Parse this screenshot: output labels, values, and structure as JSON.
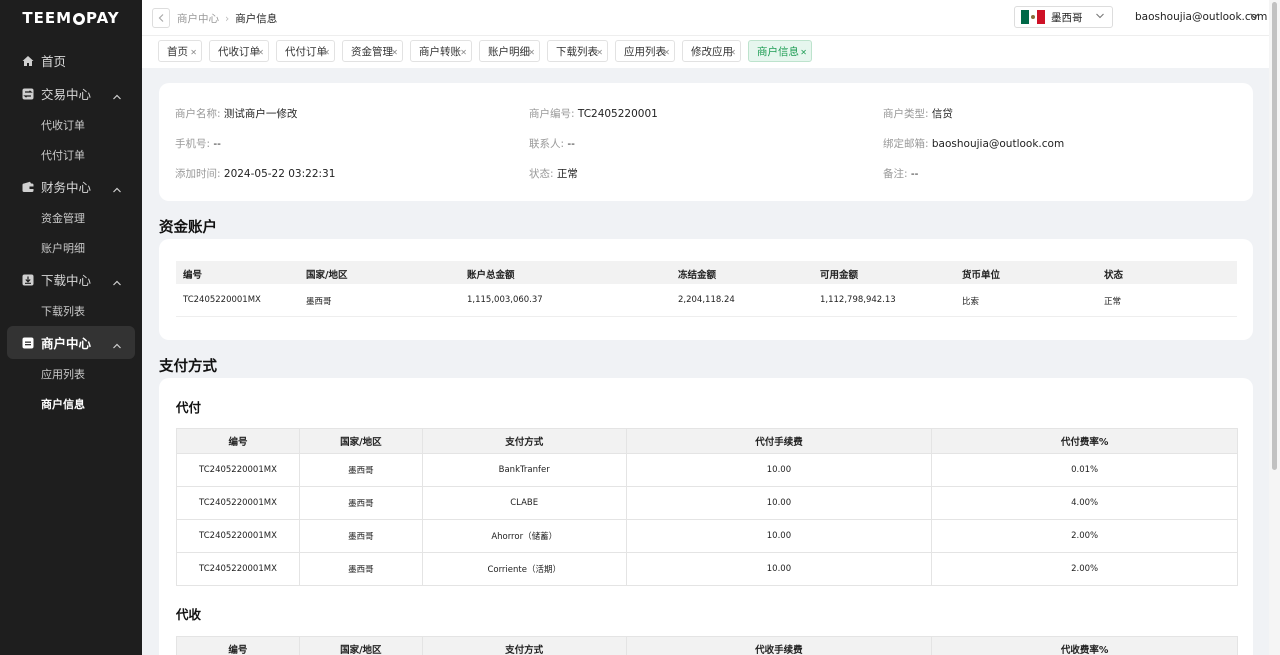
{
  "app": {
    "logo_left": "TEEM",
    "logo_right": "PAY"
  },
  "sidebar": {
    "items": [
      {
        "type": "top",
        "label": "首页",
        "icon": "home-icon",
        "name": "home"
      },
      {
        "type": "top",
        "label": "交易中心",
        "icon": "exchange-icon",
        "name": "trade-center",
        "expanded": true
      },
      {
        "type": "sub",
        "label": "代收订单",
        "name": "collection-orders"
      },
      {
        "type": "sub",
        "label": "代付订单",
        "name": "payout-orders"
      },
      {
        "type": "top",
        "label": "财务中心",
        "icon": "wallet-icon",
        "name": "finance-center",
        "expanded": true
      },
      {
        "type": "sub",
        "label": "资金管理",
        "name": "fund-management"
      },
      {
        "type": "sub",
        "label": "账户明细",
        "name": "account-details"
      },
      {
        "type": "top",
        "label": "下载中心",
        "icon": "download-icon",
        "name": "download-center",
        "expanded": true
      },
      {
        "type": "sub",
        "label": "下载列表",
        "name": "download-list"
      },
      {
        "type": "top",
        "label": "商户中心",
        "icon": "merchant-icon",
        "name": "merchant-center",
        "expanded": true,
        "active": true
      },
      {
        "type": "sub",
        "label": "应用列表",
        "name": "app-list"
      },
      {
        "type": "sub",
        "label": "商户信息",
        "name": "merchant-info",
        "active": true
      }
    ]
  },
  "header": {
    "breadcrumb": [
      "商户中心",
      "商户信息"
    ],
    "country": "墨西哥",
    "user_email": "baoshoujia@outlook.com"
  },
  "tabs": [
    {
      "label": "首页"
    },
    {
      "label": "代收订单"
    },
    {
      "label": "代付订单"
    },
    {
      "label": "资金管理"
    },
    {
      "label": "商户转账"
    },
    {
      "label": "账户明细"
    },
    {
      "label": "下载列表"
    },
    {
      "label": "应用列表"
    },
    {
      "label": "修改应用"
    },
    {
      "label": "商户信息",
      "active": true
    }
  ],
  "merchant": {
    "name_label": "商户名称:",
    "name": "测试商户一修改",
    "no_label": "商户编号:",
    "no": "TC2405220001",
    "type_label": "商户类型:",
    "type": "信贷",
    "phone_label": "手机号:",
    "phone": "--",
    "contact_label": "联系人:",
    "contact": "--",
    "email_label": "绑定邮箱:",
    "email": "baoshoujia@outlook.com",
    "added_label": "添加时间:",
    "added": "2024-05-22 03:22:31",
    "status_label": "状态:",
    "status": "正常",
    "remark_label": "备注:",
    "remark": "--"
  },
  "accounts": {
    "title": "资金账户",
    "columns": [
      "编号",
      "国家/地区",
      "账户总金额",
      "冻结金额",
      "可用金额",
      "货币单位",
      "状态"
    ],
    "rows": [
      [
        "TC2405220001MX",
        "墨西哥",
        "1,115,003,060.37",
        "2,204,118.24",
        "1,112,798,942.13",
        "比索",
        "正常"
      ]
    ]
  },
  "payment": {
    "title": "支付方式",
    "payout": {
      "title": "代付",
      "columns": [
        "编号",
        "国家/地区",
        "支付方式",
        "代付手续费",
        "代付费率%"
      ],
      "rows": [
        [
          "TC2405220001MX",
          "墨西哥",
          "BankTranfer",
          "10.00",
          "0.01%"
        ],
        [
          "TC2405220001MX",
          "墨西哥",
          "CLABE",
          "10.00",
          "4.00%"
        ],
        [
          "TC2405220001MX",
          "墨西哥",
          "Ahorror（储蓄）",
          "10.00",
          "2.00%"
        ],
        [
          "TC2405220001MX",
          "墨西哥",
          "Corriente（活期）",
          "10.00",
          "2.00%"
        ]
      ]
    },
    "collection": {
      "title": "代收",
      "columns": [
        "编号",
        "国家/地区",
        "支付方式",
        "代收手续费",
        "代收费率%"
      ]
    }
  },
  "colors": {
    "sidebar_bg": "#1e1e1e",
    "accent_green": "#1f9d55",
    "flag_green": "#006847",
    "flag_red": "#ce1126"
  }
}
